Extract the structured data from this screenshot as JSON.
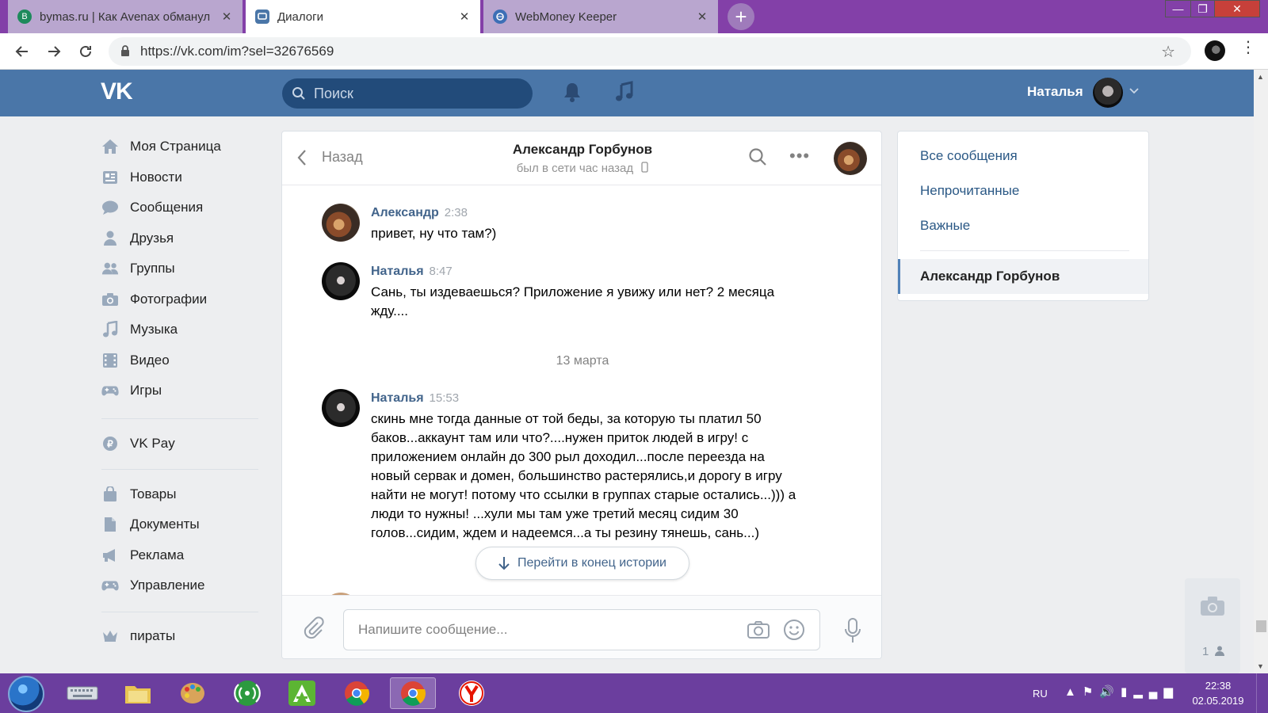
{
  "browser": {
    "tabs": [
      {
        "title": "bymas.ru | Как Avenax обманул",
        "favicon_letter": "B",
        "favicon_color": "#1e8a5c",
        "active": false
      },
      {
        "title": "Диалоги",
        "favicon_letter": "▢",
        "favicon_color": "#4a76a8",
        "active": true
      },
      {
        "title": "WebMoney Keeper",
        "favicon_letter": "◉",
        "favicon_color": "#3d6fb6",
        "active": false
      }
    ],
    "close_glyph": "✕",
    "new_tab_glyph": "+",
    "window_controls": {
      "minimize": "—",
      "maximize": "❐",
      "close": "✕"
    },
    "url": "https://vk.com/im?sel=32676569",
    "bookmark_glyph": "☆",
    "menu_glyph": "⋮",
    "accent_color": "#8340a8"
  },
  "vk_header": {
    "logo": "VK",
    "search_placeholder": "Поиск",
    "user_name": "Наталья",
    "header_color": "#4a76a8"
  },
  "left_menu": {
    "items": [
      {
        "label": "Моя Страница",
        "icon": "home-icon"
      },
      {
        "label": "Новости",
        "icon": "news-icon"
      },
      {
        "label": "Сообщения",
        "icon": "messages-icon"
      },
      {
        "label": "Друзья",
        "icon": "friends-icon"
      },
      {
        "label": "Группы",
        "icon": "groups-icon"
      },
      {
        "label": "Фотографии",
        "icon": "camera-icon"
      },
      {
        "label": "Музыка",
        "icon": "music-icon"
      },
      {
        "label": "Видео",
        "icon": "video-icon"
      },
      {
        "label": "Игры",
        "icon": "gamepad-icon"
      },
      {
        "label": "VK Pay",
        "icon": "vkpay-icon"
      },
      {
        "label": "Товары",
        "icon": "bag-icon"
      },
      {
        "label": "Документы",
        "icon": "document-icon"
      },
      {
        "label": "Реклама",
        "icon": "megaphone-icon"
      },
      {
        "label": "Управление",
        "icon": "gamepad-icon"
      },
      {
        "label": "пираты",
        "icon": "crown-icon"
      }
    ]
  },
  "dialog": {
    "back_label": "Назад",
    "peer_name": "Александр Горбунов",
    "peer_status": "был в сети час назад",
    "messages": [
      {
        "author": "Александр",
        "time": "2:38",
        "text": "привет, ну что там?)"
      },
      {
        "author": "Наталья",
        "time": "8:47",
        "text": "Сань, ты издеваешься? Приложение я увижу или нет? 2 месяца жду...."
      },
      {
        "author": "Наталья",
        "time": "15:53",
        "text": "скинь мне тогда данные от той беды, за которую ты платил 50 баков...аккаунт там или что?....нужен приток людей в игру! с приложением онлайн до 300 рыл доходил...после переезда на новый сервак и домен, большинство растерялись,и дорогу в игру найти не могут! потому что ссылки в группах старые остались...))) а люди то нужны! ...хули мы там уже третий месяц сидим 30 голов...сидим, ждем и надеемся...а ты резину тянешь, сань...)"
      }
    ],
    "date_separator": "13 марта",
    "go_to_end_label": "Перейти в конец истории",
    "input_placeholder": "Напишите сообщение..."
  },
  "filters": {
    "items": [
      "Все сообщения",
      "Непрочитанные",
      "Важные"
    ],
    "active_conversation": "Александр Горбунов"
  },
  "widget": {
    "count": "1"
  },
  "taskbar": {
    "language": "RU",
    "time": "22:38",
    "date": "02.05.2019"
  }
}
